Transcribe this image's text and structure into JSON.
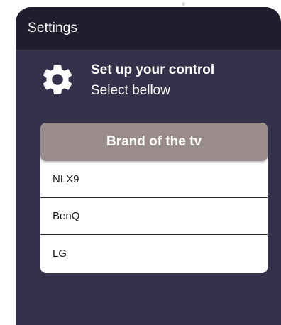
{
  "header": {
    "title": "Settings"
  },
  "intro": {
    "icon": "gear-icon",
    "title": "Set up your control",
    "subtitle": "Select bellow"
  },
  "brand_list": {
    "heading": "Brand of the tv",
    "items": [
      {
        "label": "NLX9"
      },
      {
        "label": "BenQ"
      },
      {
        "label": "LG"
      }
    ]
  },
  "colors": {
    "header_bg": "#1f1e2e",
    "panel_bg": "#33324a",
    "card_header_bg": "#9b8c8c"
  }
}
